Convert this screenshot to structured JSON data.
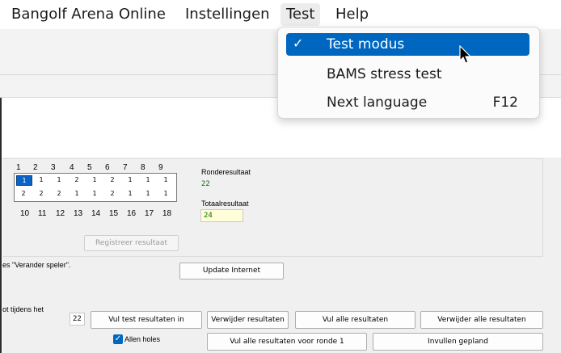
{
  "menu": {
    "items": [
      {
        "label": "Bangolf Arena Online"
      },
      {
        "label": "Instellingen"
      },
      {
        "label": "Test"
      },
      {
        "label": "Help"
      }
    ]
  },
  "test_menu": {
    "items": [
      {
        "label": "Test modus",
        "checked": true,
        "shortcut": ""
      },
      {
        "label": "BAMS stress test",
        "checked": false,
        "shortcut": ""
      },
      {
        "label": "Next language",
        "checked": false,
        "shortcut": "F12"
      }
    ],
    "check_glyph": "✓"
  },
  "scorecard": {
    "holes_top": [
      "1",
      "2",
      "3",
      "4",
      "5",
      "6",
      "7",
      "8",
      "9"
    ],
    "holes_bottom": [
      "10",
      "11",
      "12",
      "13",
      "14",
      "15",
      "16",
      "17",
      "18"
    ],
    "row1": [
      "1",
      "1",
      "1",
      "2",
      "1",
      "2",
      "1",
      "1",
      "1"
    ],
    "row2": [
      "2",
      "2",
      "2",
      "1",
      "1",
      "2",
      "1",
      "1",
      "1"
    ],
    "selected_cell": "row1-0",
    "register_button": "Registreer resultaat"
  },
  "results": {
    "round_label": "Ronderesultaat",
    "round_value": "22",
    "total_label": "Totaalresultaat",
    "total_value": "24"
  },
  "notes": {
    "change_player_text": "es \"Verander speler\".",
    "during_text": "ot tijdens het"
  },
  "actions": {
    "update_internet": "Update Internet",
    "round_number": "22",
    "fill_test_results": "Vul test resultaten in",
    "remove_results": "Verwijder resultaten",
    "fill_all_results": "Vul alle resultaten",
    "remove_all_results": "Verwijder alle resultaten",
    "all_holes_label": "Allen holes",
    "all_holes_checked": true,
    "fill_all_round1": "Vul alle resultaten voor ronde 1",
    "fill_planned": "Invullen gepland"
  },
  "colors": {
    "highlight": "#0067c0",
    "selected_cell": "#0a64c8",
    "result_text": "#007000"
  }
}
